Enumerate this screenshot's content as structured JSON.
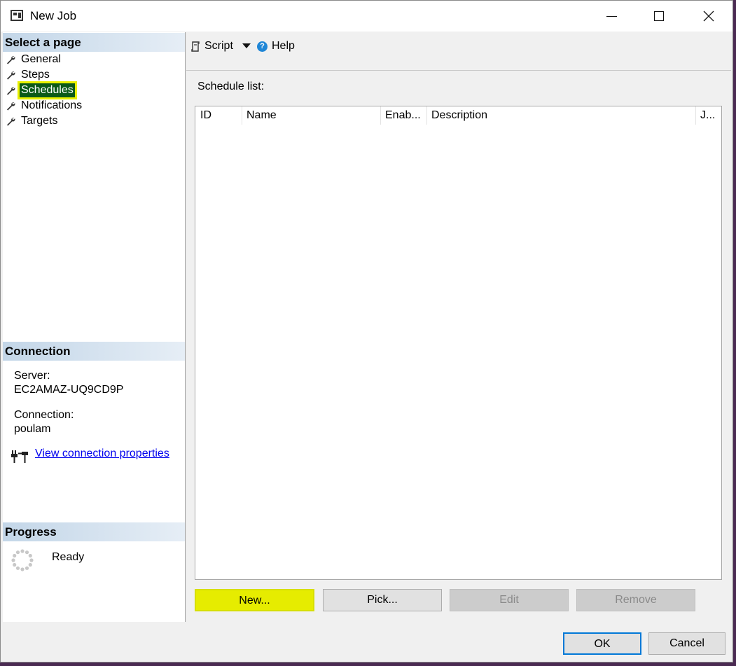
{
  "window": {
    "title": "New Job"
  },
  "left": {
    "select_page_heading": "Select a page",
    "pages": [
      {
        "label": "General"
      },
      {
        "label": "Steps"
      },
      {
        "label": "Schedules"
      },
      {
        "label": "Notifications"
      },
      {
        "label": "Targets"
      }
    ],
    "selected_page": "Schedules",
    "connection": {
      "heading": "Connection",
      "server_label": "Server:",
      "server_value": "EC2AMAZ-UQ9CD9P",
      "connection_label": "Connection:",
      "connection_value": "poulam",
      "link": "View connection properties"
    },
    "progress": {
      "heading": "Progress",
      "status": "Ready"
    }
  },
  "toolbar": {
    "script_label": "Script",
    "help_label": "Help"
  },
  "main": {
    "schedule_list_label": "Schedule list:",
    "columns": [
      "ID",
      "Name",
      "Enab...",
      "Description",
      "J..."
    ],
    "rows": [],
    "buttons": {
      "new": "New...",
      "pick": "Pick...",
      "edit": "Edit",
      "remove": "Remove"
    }
  },
  "footer": {
    "ok": "OK",
    "cancel": "Cancel"
  },
  "colors": {
    "highlight": "#e6ec00",
    "selected_bg": "#0b5a18",
    "link": "#0000ee",
    "default_button_border": "#0078d7"
  }
}
